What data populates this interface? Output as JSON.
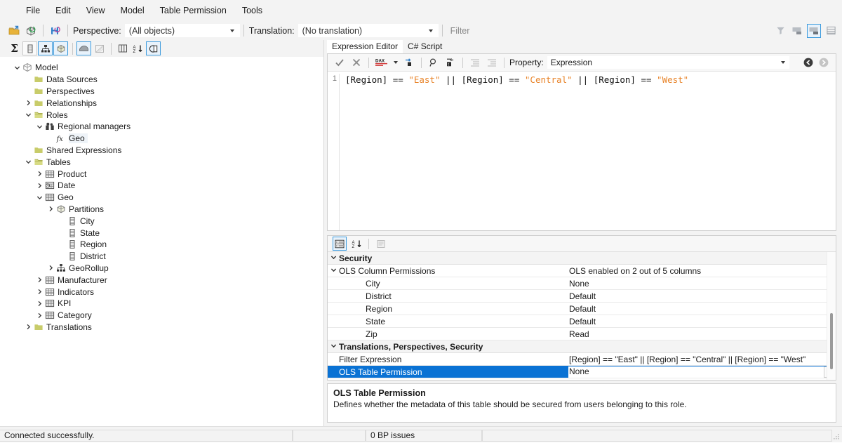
{
  "menu": {
    "items": [
      "File",
      "Edit",
      "View",
      "Model",
      "Table Permission",
      "Tools"
    ]
  },
  "toolbar": {
    "icons": [
      "open-model-icon",
      "refresh-model-icon",
      "save-model-icon"
    ],
    "perspective_label": "Perspective:",
    "perspective_value": "(All objects)",
    "translation_label": "Translation:",
    "translation_value": "(No translation)",
    "filter_placeholder": "Filter",
    "right_icons": [
      "filter-icon",
      "hide-properties-icon",
      "show-properties-icon",
      "grid-view-icon"
    ]
  },
  "left_toolbar": {
    "icons": [
      "sum-measures-icon",
      "columns-icon",
      "hierarchies-icon",
      "partitions-icon",
      "show-hidden-icon",
      "diagram-icon",
      "display-folders-icon",
      "sort-alpha-icon",
      "perspective-objects-icon"
    ]
  },
  "tree": [
    {
      "label": "Model",
      "depth": 0,
      "chev": "down",
      "icon": "model-cube-icon"
    },
    {
      "label": "Data Sources",
      "depth": 1,
      "chev": "",
      "icon": "folder-icon"
    },
    {
      "label": "Perspectives",
      "depth": 1,
      "chev": "",
      "icon": "folder-icon"
    },
    {
      "label": "Relationships",
      "depth": 1,
      "chev": "right",
      "icon": "folder-icon"
    },
    {
      "label": "Roles",
      "depth": 1,
      "chev": "down",
      "icon": "folder-open-icon"
    },
    {
      "label": "Regional managers",
      "depth": 2,
      "chev": "down",
      "icon": "role-users-icon"
    },
    {
      "label": "Geo",
      "depth": 3,
      "chev": "",
      "icon": "fx-icon",
      "highlight": true
    },
    {
      "label": "Shared Expressions",
      "depth": 1,
      "chev": "",
      "icon": "folder-icon"
    },
    {
      "label": "Tables",
      "depth": 1,
      "chev": "down",
      "icon": "folder-open-icon"
    },
    {
      "label": "Product",
      "depth": 2,
      "chev": "right",
      "icon": "table-icon"
    },
    {
      "label": "Date",
      "depth": 2,
      "chev": "right",
      "icon": "date-table-icon"
    },
    {
      "label": "Geo",
      "depth": 2,
      "chev": "down",
      "icon": "table-icon"
    },
    {
      "label": "Partitions",
      "depth": 3,
      "chev": "right",
      "icon": "partition-cube-icon"
    },
    {
      "label": "City",
      "depth": 4,
      "chev": "",
      "icon": "column-icon"
    },
    {
      "label": "State",
      "depth": 4,
      "chev": "",
      "icon": "column-icon"
    },
    {
      "label": "Region",
      "depth": 4,
      "chev": "",
      "icon": "column-icon"
    },
    {
      "label": "District",
      "depth": 4,
      "chev": "",
      "icon": "column-icon"
    },
    {
      "label": "GeoRollup",
      "depth": 3,
      "chev": "right",
      "icon": "hierarchy-icon"
    },
    {
      "label": "Manufacturer",
      "depth": 2,
      "chev": "right",
      "icon": "table-icon"
    },
    {
      "label": "Indicators",
      "depth": 2,
      "chev": "right",
      "icon": "table-icon"
    },
    {
      "label": "KPI",
      "depth": 2,
      "chev": "right",
      "icon": "table-icon"
    },
    {
      "label": "Category",
      "depth": 2,
      "chev": "right",
      "icon": "table-icon"
    },
    {
      "label": "Translations",
      "depth": 1,
      "chev": "right",
      "icon": "folder-icon"
    }
  ],
  "tabs": [
    {
      "label": "Expression Editor",
      "active": true
    },
    {
      "label": "C# Script",
      "active": false
    }
  ],
  "editor": {
    "icons": [
      "accept-check-icon",
      "cancel-x-icon",
      "dax-format-icon",
      "dax-format-dropdown-icon",
      "insert-icon",
      "find-icon",
      "convert-case-icon",
      "indent-icon",
      "outdent-icon"
    ],
    "property_label": "Property:",
    "property_value": "Expression",
    "nav_back_icon": "nav-back-icon",
    "nav_forward_icon": "nav-forward-icon",
    "line_number": "1",
    "code_tokens": [
      {
        "t": "[Region] == ",
        "k": "plain"
      },
      {
        "t": "\"East\"",
        "k": "string"
      },
      {
        "t": " || [Region] == ",
        "k": "plain"
      },
      {
        "t": "\"Central\"",
        "k": "string"
      },
      {
        "t": " || [Region] == ",
        "k": "plain"
      },
      {
        "t": "\"West\"",
        "k": "string"
      }
    ]
  },
  "property_grid": {
    "toolbar_icons": [
      "categorized-icon",
      "alphabetical-sort-icon",
      "property-pages-icon"
    ],
    "rows": [
      {
        "name": "Security",
        "value": "",
        "type": "category",
        "chev": "down",
        "indent": 0
      },
      {
        "name": "OLS Column Permissions",
        "value": "OLS enabled on 2 out of 5 columns",
        "type": "parent",
        "chev": "down",
        "indent": 0
      },
      {
        "name": "City",
        "value": "None",
        "type": "child",
        "chev": "",
        "indent": 1
      },
      {
        "name": "District",
        "value": "Default",
        "type": "child",
        "chev": "",
        "indent": 1
      },
      {
        "name": "Region",
        "value": "Default",
        "type": "child",
        "chev": "",
        "indent": 1
      },
      {
        "name": "State",
        "value": "Default",
        "type": "child",
        "chev": "",
        "indent": 1
      },
      {
        "name": "Zip",
        "value": "Read",
        "type": "child",
        "chev": "",
        "indent": 1
      },
      {
        "name": "Translations, Perspectives, Security",
        "value": "",
        "type": "category",
        "chev": "down",
        "indent": 0
      },
      {
        "name": "Filter Expression",
        "value": "[Region] == \"East\" || [Region] == \"Central\" || [Region] == \"West\"",
        "type": "item",
        "chev": "",
        "indent": 0
      },
      {
        "name": "OLS Table Permission",
        "value": "None",
        "type": "item",
        "chev": "",
        "indent": 0,
        "selected": true,
        "dropdown": true
      }
    ]
  },
  "description": {
    "title": "OLS Table Permission",
    "text": "Defines whether the metadata of this table should be secured from users belonging to this role."
  },
  "status": {
    "connection": "Connected successfully.",
    "cell2": "",
    "bp_issues": "0 BP issues",
    "cell4": ""
  },
  "colors": {
    "selection_blue": "#0a72d4",
    "string_orange": "#e8842a",
    "folder_yellow": "#c8cc6a",
    "toolbar_bg": "#f3f3f3",
    "accent_border": "#3d9bdd"
  }
}
